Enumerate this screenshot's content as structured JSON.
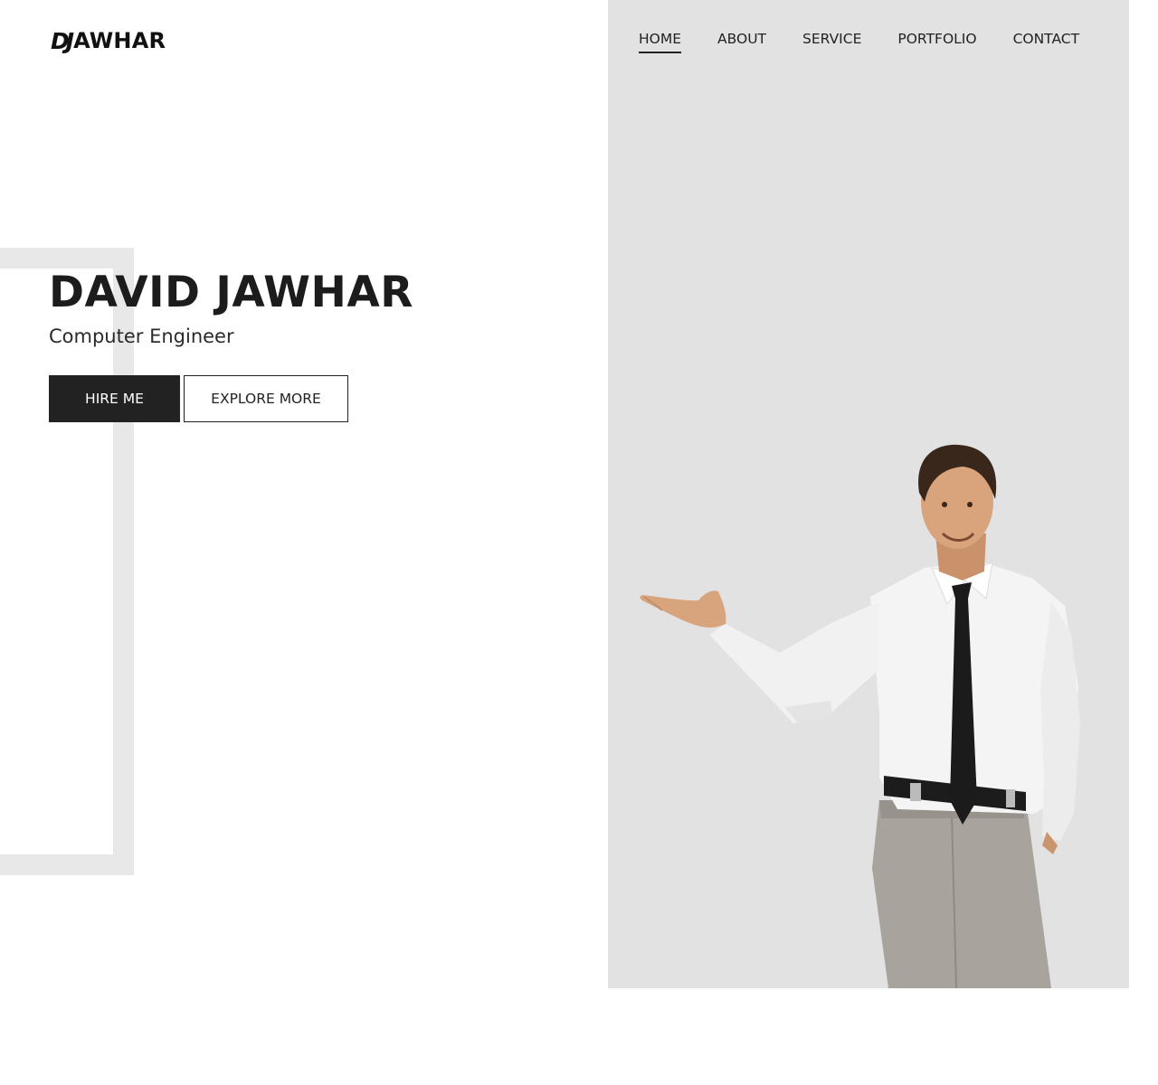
{
  "header": {
    "logo_mark": "DJ",
    "logo_text": "AWHAR",
    "nav": [
      {
        "label": "HOME",
        "active": true
      },
      {
        "label": "ABOUT",
        "active": false
      },
      {
        "label": "SERVICE",
        "active": false
      },
      {
        "label": "PORTFOLIO",
        "active": false
      },
      {
        "label": "CONTACT",
        "active": false
      }
    ]
  },
  "hero": {
    "name": "DAVID JAWHAR",
    "role": "Computer Engineer",
    "hire_label": "HIRE ME",
    "explore_label": "EXPLORE MORE"
  },
  "colors": {
    "panel_bg": "#e2e2e2",
    "accent_dark": "#222222",
    "frame": "#e8e8e8"
  },
  "image": {
    "subject": "businessman-photo"
  }
}
